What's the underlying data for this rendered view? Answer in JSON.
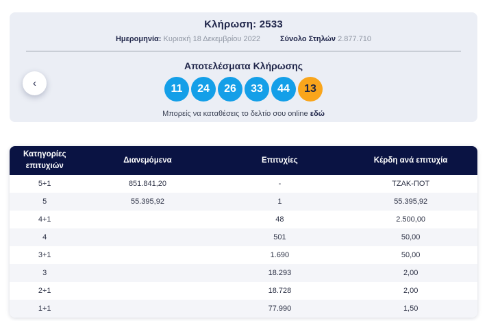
{
  "summary": {
    "draw_label": "Κλήρωση:",
    "draw_number": "2533",
    "date_label": "Ημερομηνία:",
    "date_value": "Κυριακή 18 Δεκεμβρίου 2022",
    "total_columns_label": "Σύνολο Στηλών",
    "total_columns_value": "2.877.710",
    "results_title": "Αποτελέσματα Κλήρωσης",
    "winning_numbers": [
      "11",
      "24",
      "26",
      "33",
      "44"
    ],
    "joker_number": "13",
    "note_text": "Μπορείς να καταθέσεις το δελτίο σου online",
    "note_link_label": "εδώ",
    "prev_button_glyph": "‹"
  },
  "results_table": {
    "headers": [
      "Κατηγορίες επιτυχιών",
      "Διανεμόμενα",
      "Επιτυχίες",
      "Κέρδη ανά επιτυχία"
    ],
    "rows": [
      {
        "category": "5+1",
        "distributed": "851.841,20",
        "winners": "-",
        "prize": "ΤΖΑΚ-ΠΟΤ"
      },
      {
        "category": "5",
        "distributed": "55.395,92",
        "winners": "1",
        "prize": "55.395,92"
      },
      {
        "category": "4+1",
        "distributed": "",
        "winners": "48",
        "prize": "2.500,00"
      },
      {
        "category": "4",
        "distributed": "",
        "winners": "501",
        "prize": "50,00"
      },
      {
        "category": "3+1",
        "distributed": "",
        "winners": "1.690",
        "prize": "50,00"
      },
      {
        "category": "3",
        "distributed": "",
        "winners": "18.293",
        "prize": "2,00"
      },
      {
        "category": "2+1",
        "distributed": "",
        "winners": "18.728",
        "prize": "2,00"
      },
      {
        "category": "1+1",
        "distributed": "",
        "winners": "77.990",
        "prize": "1,50"
      }
    ]
  },
  "colors": {
    "card_background": "#ebeef5",
    "table_header_background": "#0a1343",
    "ball_blue": "#149fe8",
    "ball_orange": "#f9a51b",
    "row_alternate": "#f4f5f9",
    "text_dark": "#20264a",
    "text_gray": "#8f96a3"
  }
}
